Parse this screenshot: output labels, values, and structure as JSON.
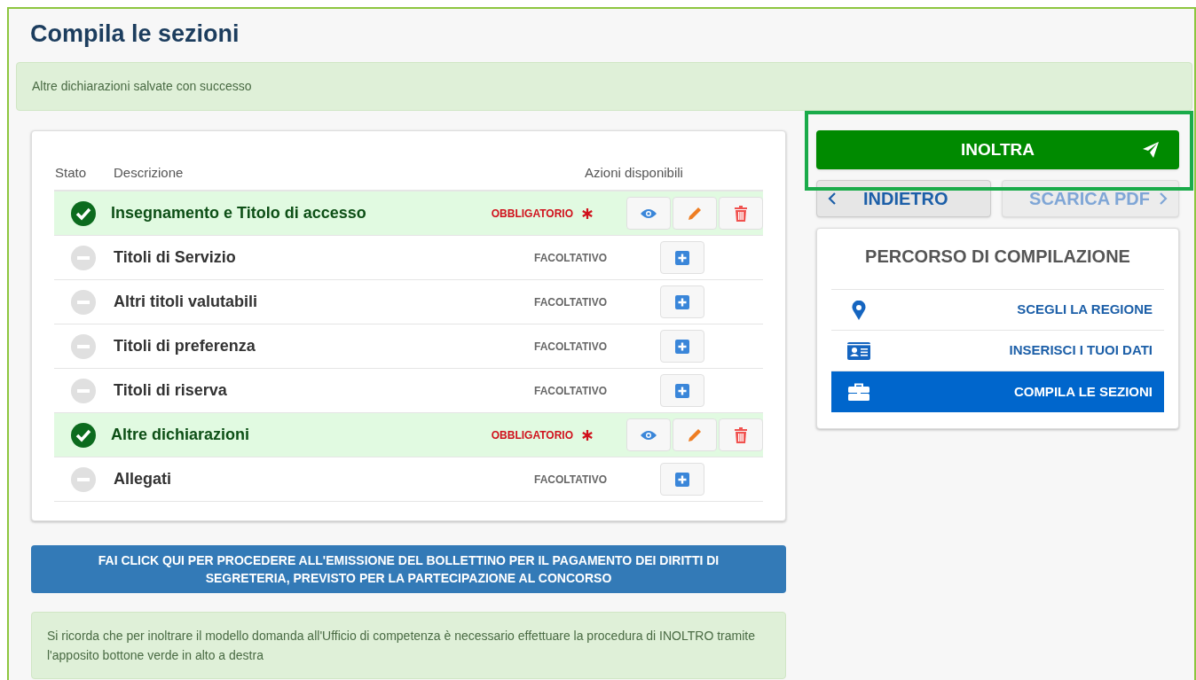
{
  "title": "Compila le sezioni",
  "alert": "Altre dichiarazioni salvate con successo",
  "table": {
    "columns": [
      "Stato",
      "Descrizione",
      "Azioni disponibili"
    ],
    "rows": [
      {
        "kind": "done",
        "description": "Insegnamento e Titolo di accesso",
        "requirement": "OBBLIGATORIO",
        "required": true,
        "actions": [
          {
            "kind": "view"
          },
          {
            "kind": "edit"
          },
          {
            "kind": "delete"
          }
        ]
      },
      {
        "kind": "todo",
        "description": "Titoli di Servizio",
        "requirement": "FACOLTATIVO",
        "required": false,
        "actions": [
          {
            "kind": "add"
          }
        ]
      },
      {
        "kind": "todo",
        "description": "Altri titoli valutabili",
        "requirement": "FACOLTATIVO",
        "required": false,
        "actions": [
          {
            "kind": "add"
          }
        ]
      },
      {
        "kind": "todo",
        "description": "Titoli di preferenza",
        "requirement": "FACOLTATIVO",
        "required": false,
        "actions": [
          {
            "kind": "add"
          }
        ]
      },
      {
        "kind": "todo",
        "description": "Titoli di riserva",
        "requirement": "FACOLTATIVO",
        "required": false,
        "actions": [
          {
            "kind": "add"
          }
        ]
      },
      {
        "kind": "done",
        "description": "Altre dichiarazioni",
        "requirement": "OBBLIGATORIO",
        "required": true,
        "actions": [
          {
            "kind": "view"
          },
          {
            "kind": "edit"
          },
          {
            "kind": "delete"
          }
        ]
      },
      {
        "kind": "todo",
        "description": "Allegati",
        "requirement": "FACOLTATIVO",
        "required": false,
        "actions": [
          {
            "kind": "add"
          }
        ]
      }
    ]
  },
  "payment_button": "FAI CLICK QUI PER PROCEDERE ALL'EMISSIONE DEL BOLLETTINO PER IL PAGAMENTO DEI DIRITTI DI SEGRETERIA, PREVISTO PER LA PARTECIPAZIONE AL CONCORSO",
  "note": "Si ricorda che per inoltrare il modello domanda all'Ufficio di competenza è necessario effettuare la procedura di INOLTRO tramite l'apposito bottone verde in alto a destra",
  "submit_button": {
    "label": "INOLTRA",
    "highlighted": true
  },
  "back_button": "INDIETRO",
  "pdf_button": {
    "label": "SCARICA PDF",
    "disabled": true
  },
  "path": {
    "title": "PERCORSO DI COMPILAZIONE",
    "steps": [
      {
        "kind": "region",
        "label": "SCEGLI LA REGIONE",
        "selected": false
      },
      {
        "kind": "data",
        "label": "INSERISCI I TUOI DATI",
        "selected": false
      },
      {
        "kind": "sections",
        "label": "COMPILA LE SEZIONI",
        "selected": true
      }
    ]
  }
}
